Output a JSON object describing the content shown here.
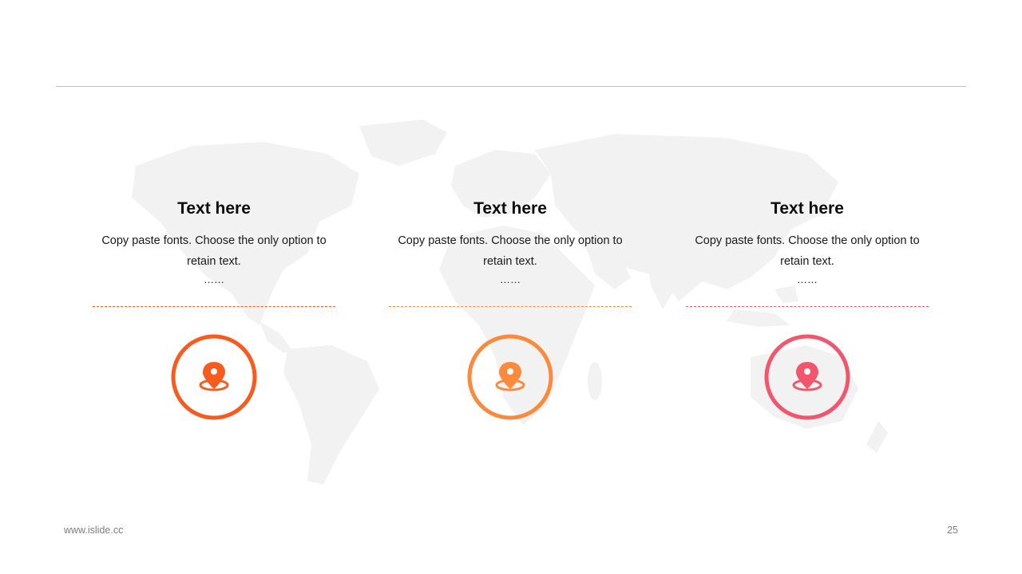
{
  "slide": {
    "footer_url": "www.islide.cc",
    "page_number": "25",
    "background_image": "world-map-silhouette"
  },
  "cards": [
    {
      "title": "Text here",
      "body": "Copy paste fonts. Choose the only option to retain text.",
      "ellipsis": "……",
      "icon": "map-pin-icon",
      "accent_color": "#f75c1e"
    },
    {
      "title": "Text here",
      "body": "Copy paste fonts. Choose the only option to retain text.",
      "ellipsis": "……",
      "icon": "map-pin-icon",
      "accent_color": "#fb8a3c"
    },
    {
      "title": "Text here",
      "body": "Copy paste fonts. Choose the only option to retain text.",
      "ellipsis": "……",
      "icon": "map-pin-icon",
      "accent_color": "#f2566d"
    }
  ]
}
